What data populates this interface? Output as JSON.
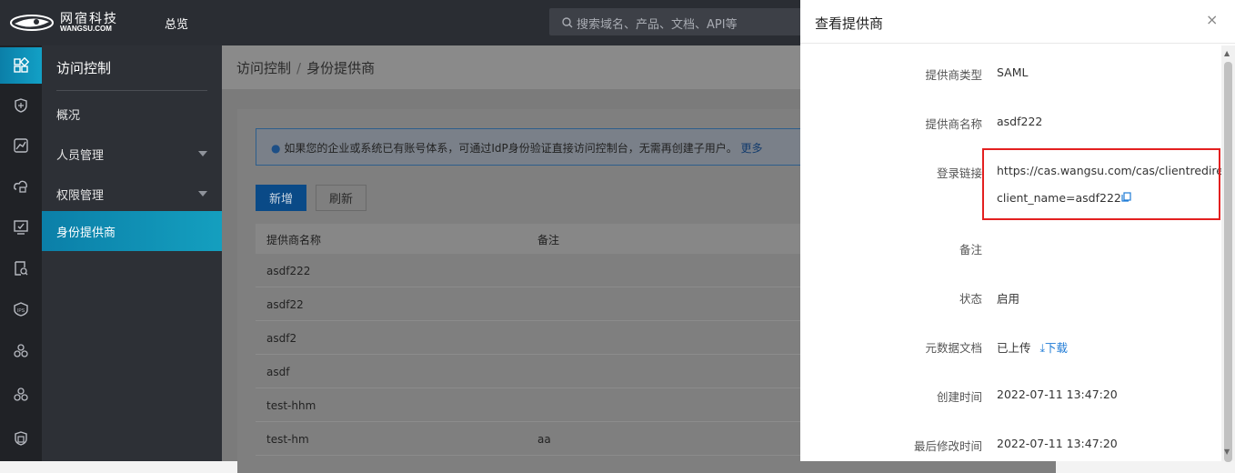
{
  "header": {
    "logo_cn": "网宿科技",
    "logo_en": "WANGSU.COM",
    "nav_overview": "总览",
    "search_placeholder": "搜索域名、产品、文档、API等"
  },
  "rail_icons": [
    "dashboard-icon",
    "shield-icon",
    "chart-icon",
    "cloud-lock-icon",
    "monitor-check-icon",
    "report-search-icon",
    "badge-icon",
    "cluster-icon",
    "cluster-alt-icon",
    "trash-shield-icon"
  ],
  "sidebar": {
    "title": "访问控制",
    "items": [
      {
        "label": "概况"
      },
      {
        "label": "人员管理"
      },
      {
        "label": "权限管理"
      },
      {
        "label": "身份提供商"
      }
    ]
  },
  "breadcrumb": {
    "parent": "访问控制",
    "sep": "/",
    "current": "身份提供商"
  },
  "notice": {
    "text": "如果您的企业或系统已有账号体系，可通过IdP身份验证直接访问控制台，无需再创建子用户。",
    "more": "更多"
  },
  "toolbar": {
    "new_label": "新增",
    "refresh_label": "刷新"
  },
  "table": {
    "columns": [
      "提供商名称",
      "备注"
    ],
    "rows": [
      {
        "name": "asdf222",
        "remark": ""
      },
      {
        "name": "asdf22",
        "remark": ""
      },
      {
        "name": "asdf2",
        "remark": ""
      },
      {
        "name": "asdf",
        "remark": ""
      },
      {
        "name": "test-hhm",
        "remark": ""
      },
      {
        "name": "test-hm",
        "remark": "aa"
      }
    ]
  },
  "drawer": {
    "title": "查看提供商",
    "close": "×",
    "fields": {
      "type_label": "提供商类型",
      "type_value": "SAML",
      "name_label": "提供商名称",
      "name_value": "asdf222",
      "login_label": "登录链接",
      "login_line1": "https://cas.wangsu.com/cas/clientredirect?",
      "login_line2": "client_name=asdf222",
      "remark_label": "备注",
      "remark_value": "",
      "status_label": "状态",
      "status_value": "启用",
      "metadata_label": "元数据文档",
      "metadata_value": "已上传",
      "download_label": "下载",
      "created_label": "创建时间",
      "created_value": "2022-07-11 13:47:20",
      "modified_label": "最后修改时间",
      "modified_value": "2022-07-11 13:47:20"
    }
  },
  "colors": {
    "accent": "#1f7bd6",
    "highlight": "#e32020",
    "active_nav": "#12a0c6"
  }
}
